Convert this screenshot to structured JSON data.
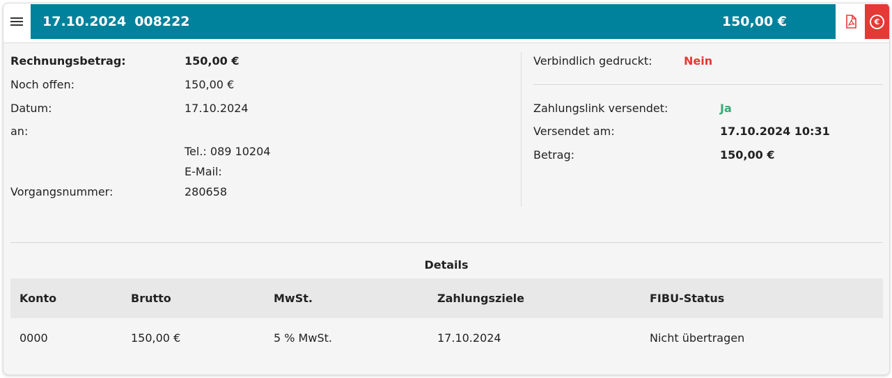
{
  "header": {
    "date": "17.10.2024",
    "number": "008222",
    "amount": "150,00 €"
  },
  "left": {
    "rows": [
      {
        "label": "Rechnungsbetrag:",
        "value": "150,00 €"
      },
      {
        "label": "Noch offen:",
        "value": "150,00 €"
      },
      {
        "label": "Datum:",
        "value": "17.10.2024"
      },
      {
        "label": "an:",
        "value": ""
      },
      {
        "label": "",
        "value": "Tel.: 089    10204"
      },
      {
        "label": "",
        "value": "E-Mail:"
      },
      {
        "label": "Vorgangsnummer:",
        "value": "280658"
      }
    ]
  },
  "right": {
    "printed_label": "Verbindlich gedruckt:",
    "printed_value": "Nein",
    "link_label": "Zahlungslink versendet:",
    "link_value": "Ja",
    "sent_label": "Versendet am:",
    "sent_value": "17.10.2024 10:31",
    "amount_label": "Betrag:",
    "amount_value": "150,00 €"
  },
  "details": {
    "title": "Details",
    "columns": [
      "Konto",
      "Brutto",
      "MwSt.",
      "Zahlungsziele",
      "FIBU-Status"
    ],
    "rows": [
      [
        "0000",
        "150,00 €",
        "5 % MwSt.",
        "17.10.2024",
        "Nicht übertragen"
      ]
    ]
  },
  "colors": {
    "header_bg": "#00819c",
    "danger": "#e53935",
    "success": "#3aa876"
  },
  "icons": [
    "menu-icon",
    "pdf-icon",
    "euro-icon"
  ]
}
